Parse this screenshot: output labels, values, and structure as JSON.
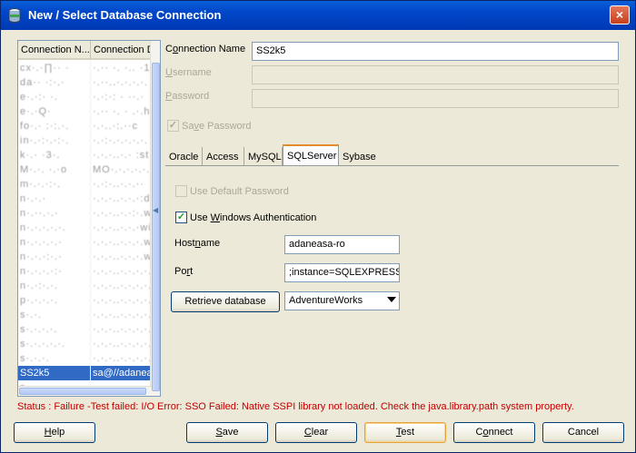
{
  "window": {
    "title": "New / Select Database Connection",
    "close_glyph": "×",
    "title_icon": "database-icon"
  },
  "connection_list": {
    "columns": [
      "Connection N...",
      "Connection D"
    ],
    "rows": [
      {
        "name": "cx·.·∏·· ·",
        "detail": "·.·· ·. ·.. ·1_"
      },
      {
        "name": "da·· ·:·.·",
        "detail": "·.··..·.·.·.·."
      },
      {
        "name": "e·.·:· ·.",
        "detail": "·.·:·: · ··.·"
      },
      {
        "name": "e·.·Q·",
        "detail": "·.·· ·. · .·.h"
      },
      {
        "name": "fo·.· :·:.·.",
        "detail": "·.·..·:.··c"
      },
      {
        "name": "in·.·:·.·:·.",
        "detail": "·.·:·.·.·.·.·."
      },
      {
        "name": "k·.· ·3·.",
        "detail": "·.·.·..·.· :st"
      },
      {
        "name": "M·.·. ·.·o",
        "detail": "MO·.·.·.·.·.·."
      },
      {
        "name": "m·.·.·:·.",
        "detail": "·.·:·..·.·.··"
      },
      {
        "name": "n·.·.·",
        "detail": "·.·.·..·.·.·:dh"
      },
      {
        "name": "n·.··.·.·",
        "detail": "·.·.·..·.·:·.w"
      },
      {
        "name": "n·.·.·.·.·.",
        "detail": "·.·.·..·.·.·win"
      },
      {
        "name": "n·.·.·.·.·",
        "detail": "·.·.·..·.·.·.w"
      },
      {
        "name": "n·.·.·:·.·",
        "detail": "·.·.·..·.·.·.w"
      },
      {
        "name": "n·.·.·.·:·",
        "detail": "·.·.·..·.·.·.·."
      },
      {
        "name": "n·.·:·.·.",
        "detail": "·.·.·..·.·.·.·."
      },
      {
        "name": "p·.·.·.·.",
        "detail": "·.·.·..·.·.·.·."
      },
      {
        "name": "s·.·.",
        "detail": "·.·.·..·.·.·.·."
      },
      {
        "name": "s·.·.·.·.",
        "detail": "·.·.·..·.·.·.·."
      },
      {
        "name": "s·.·.·.·.·.",
        "detail": "·.·.·..·.·.·.·."
      },
      {
        "name": "s·.·.·.",
        "detail": "·.·.·..·.·.·.·."
      },
      {
        "name": "SS2k5",
        "detail": "sa@//adanea",
        "selected": true
      },
      {
        "name": "s·.·.·.·.",
        "detail": "·.·.·..·.·.·.·."
      },
      {
        "name": "s·.·.·.·.·",
        "detail": "·.·.·..·.·.·.·."
      }
    ]
  },
  "form": {
    "connection_name_label": "Connection Name",
    "connection_name_value": "SS2k5",
    "username_label": "Username",
    "username_value": "",
    "password_label": "Password",
    "password_value": "",
    "save_password_label": "Save Password",
    "save_password_checked": true
  },
  "tabs": [
    {
      "label": "Oracle",
      "active": false
    },
    {
      "label": "Access",
      "active": false
    },
    {
      "label": "MySQL",
      "active": false
    },
    {
      "label": "SQLServer",
      "active": true
    },
    {
      "label": "Sybase",
      "active": false
    }
  ],
  "sqlserver": {
    "use_default_password_label": "Use Default Password",
    "use_default_password_checked": false,
    "use_windows_auth_label": "Use Windows Authentication",
    "use_windows_auth_checked": true,
    "hostname_label": "Hostname",
    "hostname_value": "adaneasa-ro",
    "port_label": "Port",
    "port_value": ";instance=SQLEXPRESS",
    "retrieve_button": "Retrieve database",
    "database_selected": "AdventureWorks"
  },
  "status": "Status : Failure -Test failed: I/O Error: SSO Failed: Native SSPI library not loaded. Check the java.library.path system property.",
  "buttons": {
    "help": "Help",
    "save": "Save",
    "clear": "Clear",
    "test": "Test",
    "connect": "Connect",
    "cancel": "Cancel"
  },
  "colors": {
    "status_text": "#c00000",
    "selected_row": "#316ac5",
    "title_bar": "#0046c8"
  }
}
